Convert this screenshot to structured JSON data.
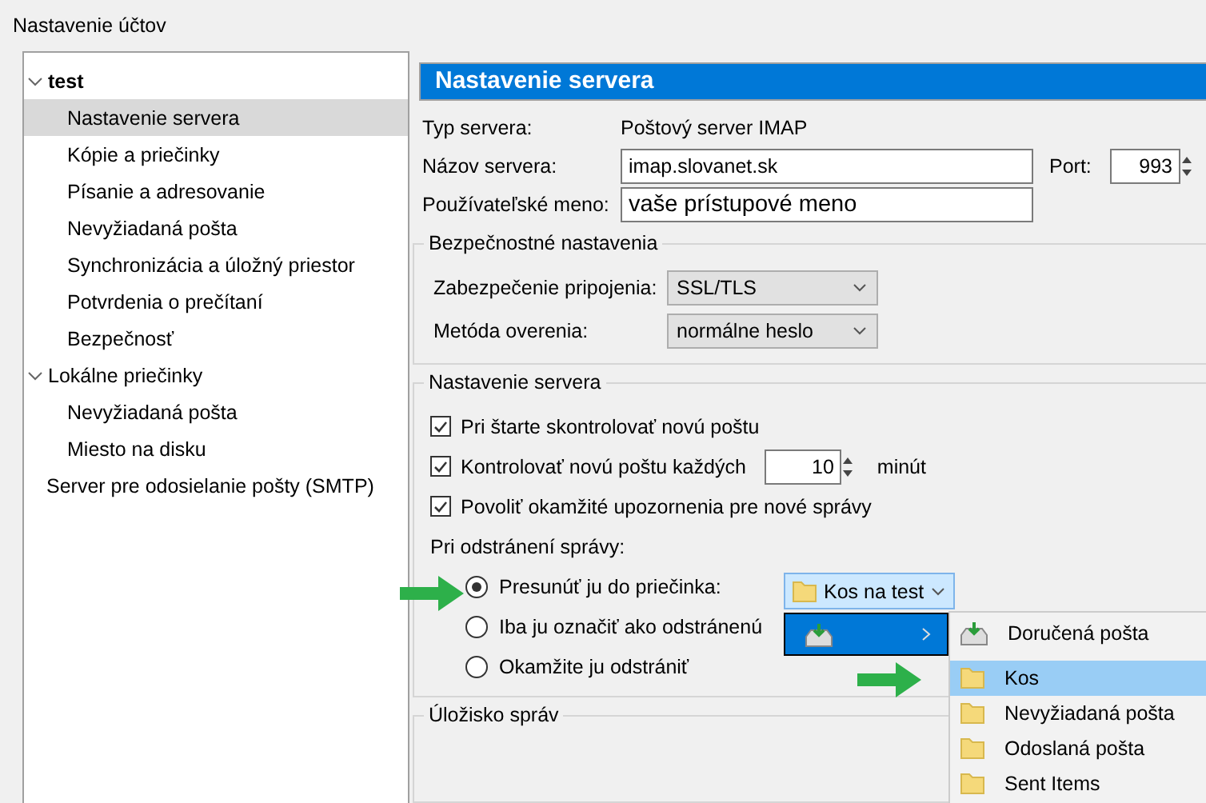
{
  "window": {
    "title": "Nastavenie účtov"
  },
  "tree": [
    {
      "label": "test",
      "kind": "account",
      "expanded": true,
      "selected": false,
      "children": [
        {
          "label": "Nastavenie servera",
          "selected": true
        },
        {
          "label": "Kópie a priečinky",
          "selected": false
        },
        {
          "label": "Písanie a adresovanie",
          "selected": false
        },
        {
          "label": "Nevyžiadaná pošta",
          "selected": false
        },
        {
          "label": "Synchronizácia a úložný priestor",
          "selected": false
        },
        {
          "label": "Potvrdenia o prečítaní",
          "selected": false
        },
        {
          "label": "Bezpečnosť",
          "selected": false
        }
      ]
    },
    {
      "label": "Lokálne priečinky",
      "kind": "group",
      "expanded": true,
      "selected": false,
      "children": [
        {
          "label": "Nevyžiadaná pošta",
          "selected": false
        },
        {
          "label": "Miesto na disku",
          "selected": false
        }
      ]
    },
    {
      "label": "Server pre odosielanie pošty (SMTP)",
      "kind": "item",
      "selected": false
    }
  ],
  "panel": {
    "title": "Nastavenie servera",
    "server_type": {
      "label": "Typ servera:",
      "value": "Poštový server IMAP"
    },
    "server_name": {
      "label": "Názov servera:",
      "value": "imap.slovanet.sk"
    },
    "port": {
      "label": "Port:",
      "value": "993"
    },
    "username": {
      "label": "Používateľské meno:",
      "value": "vaše prístupové meno"
    },
    "security": {
      "legend": "Bezpečnostné nastavenia",
      "fields": [
        {
          "label": "Zabezpečenie pripojenia:",
          "value": "SSL/TLS"
        },
        {
          "label": "Metóda overenia:",
          "value": "normálne heslo"
        }
      ]
    },
    "server_settings": {
      "legend": "Nastavenie servera",
      "checks": [
        {
          "kind": "plain",
          "label": "Pri štarte skontrolovať novú poštu",
          "checked": true
        },
        {
          "kind": "interval",
          "label": "Kontrolovať novú poštu každých",
          "checked": true,
          "minutes": "10",
          "unit": "minút"
        },
        {
          "kind": "plain",
          "label": "Povoliť okamžité upozornenia pre nové správy",
          "checked": true
        }
      ],
      "delete_label": "Pri odstránení správy:",
      "radios": [
        {
          "label": "Presunúť ju do priečinka:",
          "selected": true
        },
        {
          "label": "Iba ju označiť ako odstránenú",
          "selected": false
        },
        {
          "label": "Okamžite ju odstrániť",
          "selected": false
        }
      ],
      "folder_select": {
        "value": "Kos na test"
      }
    },
    "storage": {
      "legend": "Úložisko správ"
    }
  },
  "folder_menu": {
    "account_item": {
      "selected": true
    },
    "submenu": [
      {
        "kind": "inbox",
        "label": "Doručená pošta",
        "selected": false
      },
      {
        "kind": "folder",
        "label": "Kos",
        "selected": true
      },
      {
        "kind": "folder",
        "label": "Nevyžiadaná pošta",
        "selected": false
      },
      {
        "kind": "folder",
        "label": "Odoslaná pošta",
        "selected": false
      },
      {
        "kind": "folder",
        "label": "Sent Items",
        "selected": false
      }
    ]
  }
}
